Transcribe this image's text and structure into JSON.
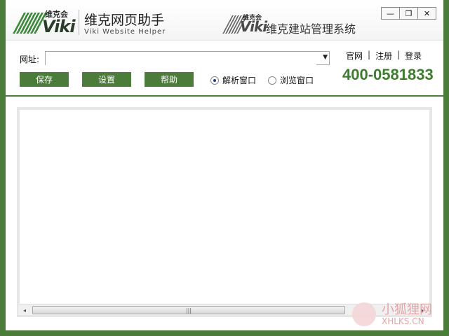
{
  "header": {
    "logo_cn": "维克会",
    "logo_word": "Viki",
    "app_title": "维克网页助手",
    "app_subtitle": "Viki Website Helper",
    "system_logo_cn": "维克会",
    "system_logo_word": "Viki",
    "system_name": "维克建站管理系统",
    "window_controls": [
      {
        "label": "—",
        "icon": "minimize-icon"
      },
      {
        "label": "❐",
        "icon": "restore-icon"
      },
      {
        "label": "✕",
        "icon": "close-icon"
      }
    ]
  },
  "toolbar": {
    "url_label": "网址:",
    "url_value": "",
    "url_placeholder": "",
    "buttons": [
      "保存",
      "设置",
      "帮助"
    ],
    "radio_options": [
      {
        "label": "解析窗口",
        "checked": true
      },
      {
        "label": "浏览窗口",
        "checked": false
      }
    ],
    "links": [
      "官网",
      "注册",
      "登录"
    ],
    "phone": "400-0581833"
  },
  "content": {
    "scroll_left": "◂",
    "scroll_right": "▸",
    "scroll_grip": "|||"
  },
  "watermark": {
    "cn": "小狐狸网",
    "en": "XHLKS.CN"
  },
  "colors": {
    "accent": "#4c7c3a",
    "phone": "#3e7d2f"
  }
}
